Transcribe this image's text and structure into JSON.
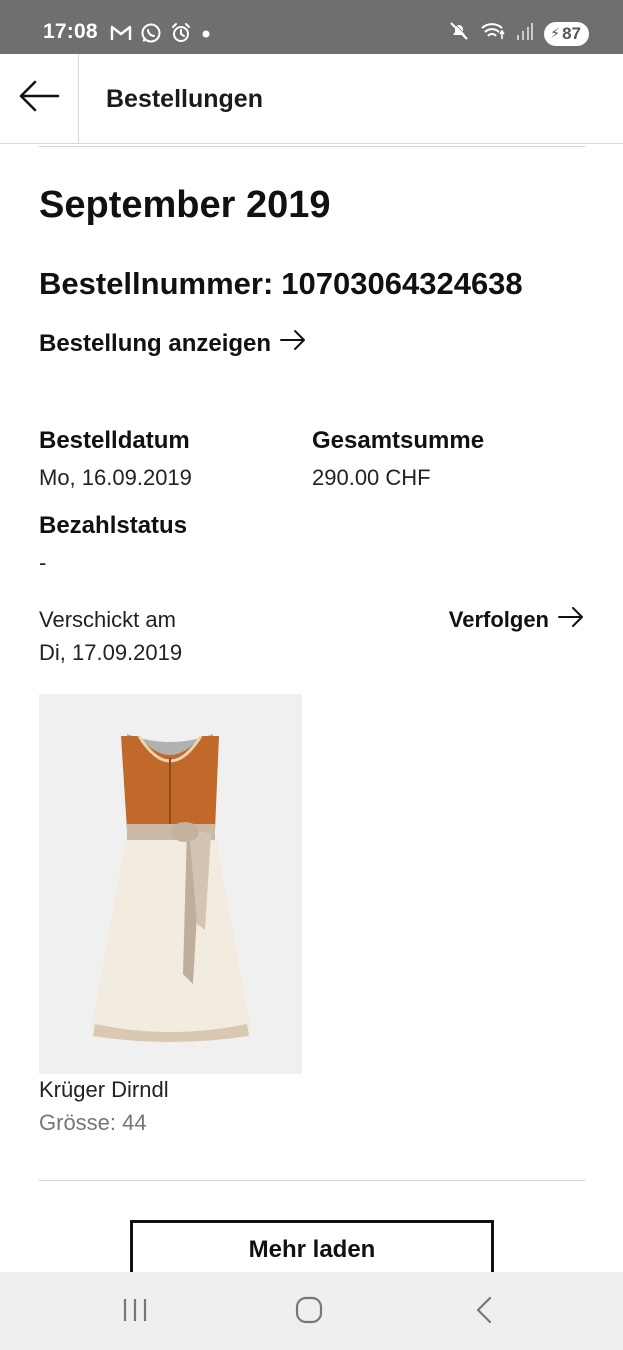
{
  "status_bar": {
    "time": "17:08",
    "battery": "87",
    "icons_left": [
      "gmail-icon",
      "whatsapp-icon",
      "alarm-icon",
      "dot-icon"
    ],
    "icons_right": [
      "mute-icon",
      "wifi-icon",
      "signal-icon",
      "battery-icon"
    ]
  },
  "app_bar": {
    "title": "Bestellungen",
    "back_icon": "arrow-left-icon"
  },
  "order": {
    "month": "September 2019",
    "number_label": "Bestellnummer:",
    "number": "10703064324638",
    "show_order_label": "Bestellung anzeigen",
    "order_date_label": "Bestelldatum",
    "order_date": "Mo, 16.09.2019",
    "total_label": "Gesamtsumme",
    "total": "290.00 CHF",
    "payment_status_label": "Bezahlstatus",
    "payment_status": "-",
    "shipped_label": "Verschickt am",
    "shipped_date": "Di, 17.09.2019",
    "track_label": "Verfolgen"
  },
  "product": {
    "name": "Krüger Dirndl",
    "size": "Grösse: 44",
    "colors": {
      "bodice": "#c0692a",
      "apron": "#f2ece0",
      "sash": "#cbb9a8"
    }
  },
  "load_more_label": "Mehr laden",
  "nav_bar": {
    "buttons": [
      "recent-apps-icon",
      "home-icon",
      "back-icon"
    ]
  }
}
